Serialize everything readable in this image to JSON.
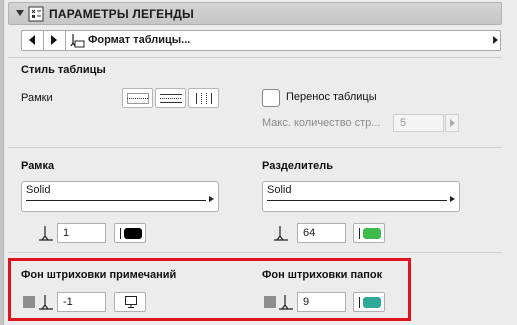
{
  "header": {
    "title": "ПАРАМЕТРЫ ЛЕГЕНДЫ"
  },
  "nav": {
    "title": "Формат таблицы..."
  },
  "table_style": {
    "section_label": "Стиль таблицы",
    "frames_label": "Рамки",
    "wrap_label": "Перенос таблицы",
    "max_count_label": "Макс. количество стр...",
    "max_count_value": "5"
  },
  "frame": {
    "label": "Рамка",
    "line_type": "Solid",
    "pen_value": "1",
    "pen_color": "#000000"
  },
  "divider": {
    "label": "Разделитель",
    "line_type": "Solid",
    "pen_value": "64",
    "pen_color": "#3dbb4a"
  },
  "note_hatch": {
    "label": "Фон штриховки примечаний",
    "pen_value": "-1"
  },
  "folder_hatch": {
    "label": "Фон штриховки папок",
    "pen_value": "9",
    "pen_color": "#2ea898"
  }
}
